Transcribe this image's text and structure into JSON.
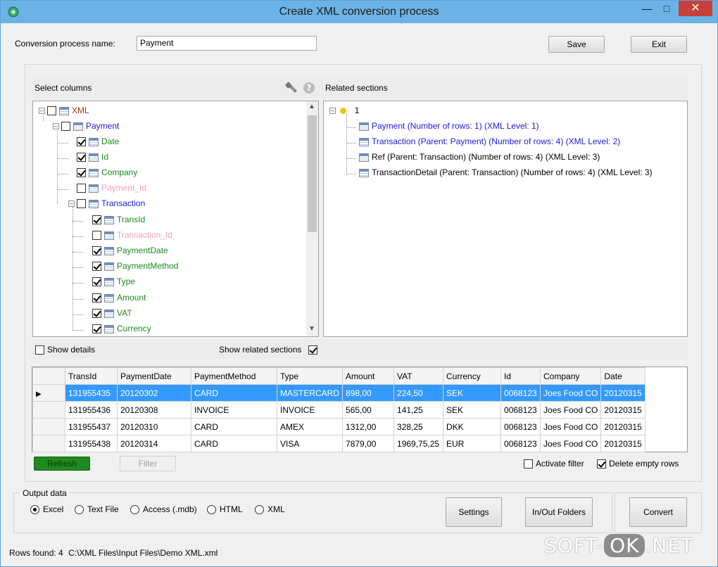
{
  "window": {
    "title": "Create XML conversion process"
  },
  "form": {
    "name_label": "Conversion process name:",
    "name_value": "Payment",
    "save_label": "Save",
    "exit_label": "Exit"
  },
  "select_columns": {
    "header": "Select columns",
    "items": [
      {
        "label": "XML",
        "checked": false,
        "color": "#b03020"
      },
      {
        "label": "Payment",
        "checked": false,
        "color": "#1a1ae0"
      },
      {
        "label": "Date",
        "checked": true,
        "color": "#1a8a1a"
      },
      {
        "label": "Id",
        "checked": true,
        "color": "#1a8a1a"
      },
      {
        "label": "Company",
        "checked": true,
        "color": "#1a8a1a"
      },
      {
        "label": "Payment_Id",
        "checked": false,
        "color": "#f0a0c0"
      },
      {
        "label": "Transaction",
        "checked": false,
        "color": "#1a1ae0"
      },
      {
        "label": "TransId",
        "checked": true,
        "color": "#1a8a1a"
      },
      {
        "label": "Transaction_Id",
        "checked": false,
        "color": "#f0a0c0"
      },
      {
        "label": "PaymentDate",
        "checked": true,
        "color": "#1a8a1a"
      },
      {
        "label": "PaymentMethod",
        "checked": true,
        "color": "#1a8a1a"
      },
      {
        "label": "Type",
        "checked": true,
        "color": "#1a8a1a"
      },
      {
        "label": "Amount",
        "checked": true,
        "color": "#1a8a1a"
      },
      {
        "label": "VAT",
        "checked": true,
        "color": "#1a8a1a"
      },
      {
        "label": "Currency",
        "checked": true,
        "color": "#1a8a1a"
      }
    ],
    "show_details_label": "Show details",
    "show_related_label": "Show related sections"
  },
  "related_sections": {
    "header": "Related sections",
    "root": "1",
    "items": [
      {
        "label": "Payment (Number of rows: 1) (XML Level: 1)",
        "color": "#1a1ae0"
      },
      {
        "label": "Transaction (Parent: Payment) (Number of rows: 4) (XML Level: 2)",
        "color": "#1a1ae0"
      },
      {
        "label": "Ref (Parent: Transaction) (Number of rows: 4) (XML Level: 3)",
        "color": "#000000"
      },
      {
        "label": "TransactionDetail (Parent: Transaction) (Number of rows: 4) (XML Level: 3)",
        "color": "#000000"
      }
    ]
  },
  "grid": {
    "columns": [
      "TransId",
      "PaymentDate",
      "PaymentMethod",
      "Type",
      "Amount",
      "VAT",
      "Currency",
      "Id",
      "Company",
      "Date"
    ],
    "rows": [
      [
        "131955435",
        "20120302",
        "CARD",
        "MASTERCARD",
        "898,00",
        "224,50",
        "SEK",
        "0068123",
        "Joes Food CO",
        "20120315"
      ],
      [
        "131955436",
        "20120308",
        "INVOICE",
        "INVOICE",
        "565,00",
        "141,25",
        "SEK",
        "0068123",
        "Joes Food CO",
        "20120315"
      ],
      [
        "131955437",
        "20120310",
        "CARD",
        "AMEX",
        "1312,00",
        "328,25",
        "DKK",
        "0068123",
        "Joes Food CO",
        "20120315"
      ],
      [
        "131955438",
        "20120314",
        "CARD",
        "VISA",
        "7879,00",
        "1969,75,25",
        "EUR",
        "0068123",
        "Joes Food CO",
        "20120315"
      ]
    ],
    "refresh_label": "Refresh",
    "filter_label": "Filter",
    "activate_filter_label": "Activate filter",
    "delete_empty_label": "Delete empty rows"
  },
  "output": {
    "group_label": "Output data",
    "options": [
      "Excel",
      "Text File",
      "Access (.mdb)",
      "HTML",
      "XML"
    ],
    "settings_label": "Settings",
    "folders_label": "In/Out Folders",
    "convert_label": "Convert"
  },
  "status": {
    "rows_found": "Rows found: 4",
    "path": "C:\\XML Files\\Input Files\\Demo XML.xml"
  },
  "watermark": {
    "left": "SOFT-",
    "mid": "OK",
    "right": ".NET"
  },
  "colors": {
    "accent": "#3399ff",
    "refresh": "#1f8a1f",
    "titlebar": "#6bb3e6"
  }
}
